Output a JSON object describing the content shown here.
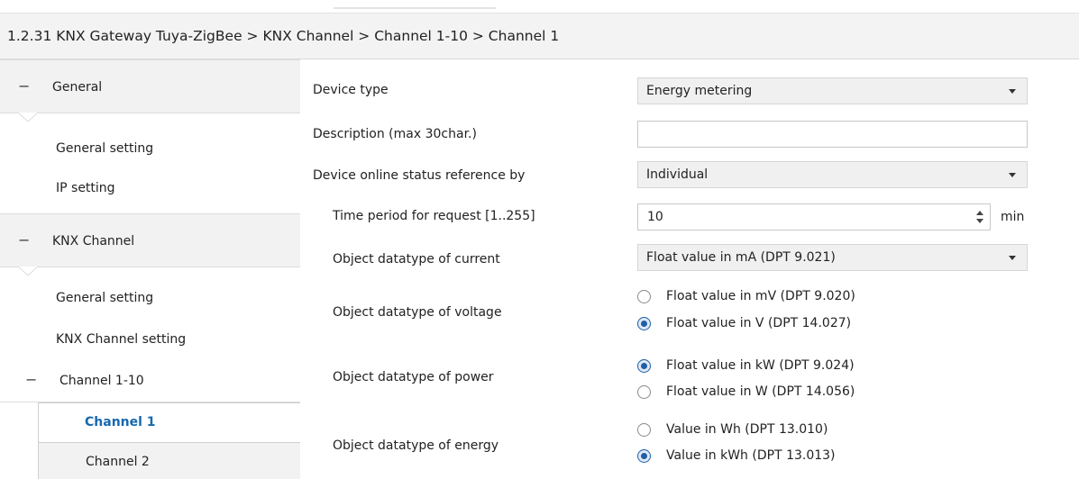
{
  "header": {
    "breadcrumb": "1.2.31 KNX Gateway Tuya-ZigBee > KNX Channel > Channel 1-10 > Channel 1"
  },
  "sidebar": {
    "general": {
      "label": "General",
      "items": [
        "General setting",
        "IP setting"
      ]
    },
    "knx_channel": {
      "label": "KNX Channel",
      "items": [
        "General setting",
        "KNX Channel setting"
      ]
    },
    "channel_group": {
      "label": "Channel 1-10",
      "selected": "Channel 1",
      "next": "Channel 2"
    },
    "collapse_glyph": "−"
  },
  "form": {
    "device_type": {
      "label": "Device type",
      "value": "Energy metering"
    },
    "description": {
      "label": "Description (max 30char.)",
      "value": ""
    },
    "online_status": {
      "label": "Device online status reference by",
      "value": "Individual"
    },
    "time_period": {
      "label": "Time period for request [1..255]",
      "value": "10",
      "unit": "min"
    },
    "current": {
      "label": "Object datatype of current",
      "value": "Float value in mA (DPT 9.021)"
    },
    "voltage": {
      "label": "Object datatype of voltage",
      "options": [
        "Float value in mV (DPT 9.020)",
        "Float value in V (DPT 14.027)"
      ],
      "selected": 1
    },
    "power": {
      "label": "Object datatype of power",
      "options": [
        "Float value in kW (DPT 9.024)",
        "Float value in W (DPT 14.056)"
      ],
      "selected": 0
    },
    "energy": {
      "label": "Object datatype of energy",
      "options": [
        "Value in Wh (DPT 13.010)",
        "Value in kWh (DPT 13.013)"
      ],
      "selected": 1
    }
  },
  "colors": {
    "accent": "#1668b0",
    "header_bg": "#f3f3f3",
    "select_bg": "#f0f0f0"
  }
}
